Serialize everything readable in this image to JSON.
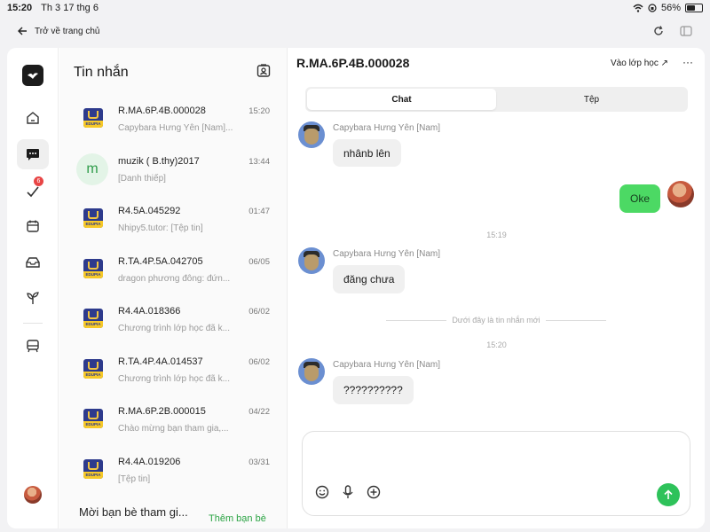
{
  "statusbar": {
    "time": "15:20",
    "date": "Th 3 17 thg 6",
    "battery": "56%",
    "battery_level": 0.56
  },
  "topnav": {
    "back_label": "Trở về trang chủ"
  },
  "sidebar": {
    "notification_badge": "6"
  },
  "conversations": {
    "title": "Tin nhắn",
    "items": [
      {
        "name": "R.MA.6P.4B.000028",
        "time": "15:20",
        "preview": "Capybara Hưng Yên [Nam]...",
        "avatar": "edupia"
      },
      {
        "name": "muzik ( B.thy)2017",
        "time": "13:44",
        "preview": "[Danh thiếp]",
        "avatar": "m"
      },
      {
        "name": "R4.5A.045292",
        "time": "01:47",
        "preview": "Nhipy5.tutor: [Tệp tin]",
        "avatar": "edupia"
      },
      {
        "name": "R.TA.4P.5A.042705",
        "time": "06/05",
        "preview": "dragon phương đông: đứn...",
        "avatar": "edupia"
      },
      {
        "name": "R4.4A.018366",
        "time": "06/02",
        "preview": "Chương trình lớp học đã k...",
        "avatar": "edupia"
      },
      {
        "name": "R.TA.4P.4A.014537",
        "time": "06/02",
        "preview": "Chương trình lớp học đã k...",
        "avatar": "edupia"
      },
      {
        "name": "R.MA.6P.2B.000015",
        "time": "04/22",
        "preview": "Chào mừng bạn tham gia,...",
        "avatar": "edupia"
      },
      {
        "name": "R4.4A.019206",
        "time": "03/31",
        "preview": "[Tệp tin]",
        "avatar": "edupia"
      }
    ],
    "avatar_logo_text": "EDUPIA",
    "invite_label": "Mời bạn bè tham gi...",
    "add_friend_label": "Thêm bạn bè"
  },
  "chat": {
    "title": "R.MA.6P.4B.000028",
    "join_label": "Vào lớp học ↗",
    "more_label": "···",
    "tabs": [
      {
        "label": "Chat"
      },
      {
        "label": "Tệp"
      }
    ],
    "messages": [
      {
        "sender": "Capybara Hưng Yên [Nam]",
        "text": "nhânb lên"
      },
      {
        "sender": "me",
        "text": "Oke"
      },
      {
        "sender": "Capybara Hưng Yên [Nam]",
        "text": "đăng chưa"
      },
      {
        "sender": "Capybara Hưng Yên [Nam]",
        "text": "??????????"
      }
    ],
    "timestamps": [
      "15:19",
      "15:20"
    ],
    "new_messages_divider": "Dưới đây là tin nhắn mới"
  },
  "colors": {
    "accent": "#2ec25a",
    "my_bubble": "#4cd964",
    "badge": "#e84545"
  }
}
